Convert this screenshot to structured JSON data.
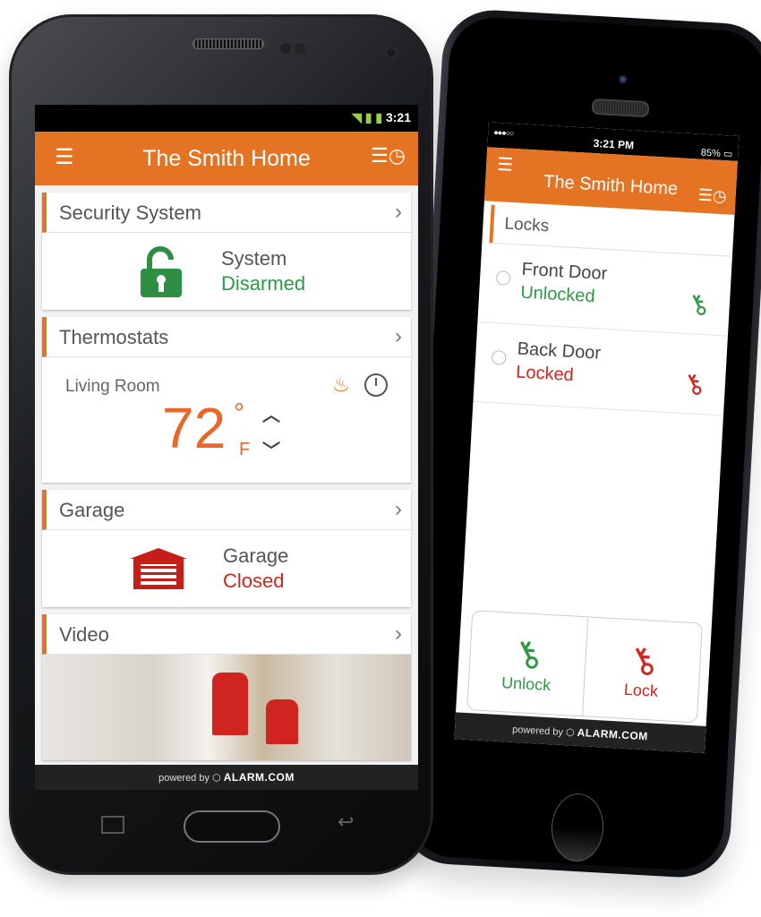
{
  "android": {
    "status_time": "3:21",
    "header": {
      "title": "The Smith Home",
      "menu_icon": "hamburger-menu-icon",
      "schedule_icon": "schedule-clock-icon"
    },
    "cards": {
      "security": {
        "title": "Security System",
        "line1": "System",
        "line2": "Disarmed"
      },
      "thermostat": {
        "title": "Thermostats",
        "room": "Living Room",
        "temperature": "72",
        "degree": "°",
        "unit": "F",
        "mode_icon": "flame-icon",
        "schedule_icon": "clock-icon"
      },
      "garage": {
        "title": "Garage",
        "line1": "Garage",
        "line2": "Closed"
      },
      "video": {
        "title": "Video"
      }
    },
    "powered_by": "powered by",
    "brand": "ALARM.COM"
  },
  "iphone": {
    "status": {
      "time": "3:21 PM",
      "battery": "85%",
      "signal": "●●●○○"
    },
    "header": {
      "title": "The Smith Home"
    },
    "section": "Locks",
    "locks": [
      {
        "name": "Front Door",
        "state": "Unlocked",
        "color": "#2e9a43"
      },
      {
        "name": "Back Door",
        "state": "Locked",
        "color": "#d0261e"
      }
    ],
    "actions": {
      "unlock": "Unlock",
      "lock": "Lock"
    },
    "powered_by": "powered by",
    "brand": "ALARM.COM"
  },
  "glyphs": {
    "menu": "☰",
    "schedule": "☰◷",
    "chevron": "›",
    "key": "⚷",
    "flame": "♨",
    "up": "︿",
    "down": "﹀",
    "back": "↩"
  },
  "colors": {
    "accent": "#e47424",
    "green": "#2e9a43",
    "red": "#d0261e"
  }
}
